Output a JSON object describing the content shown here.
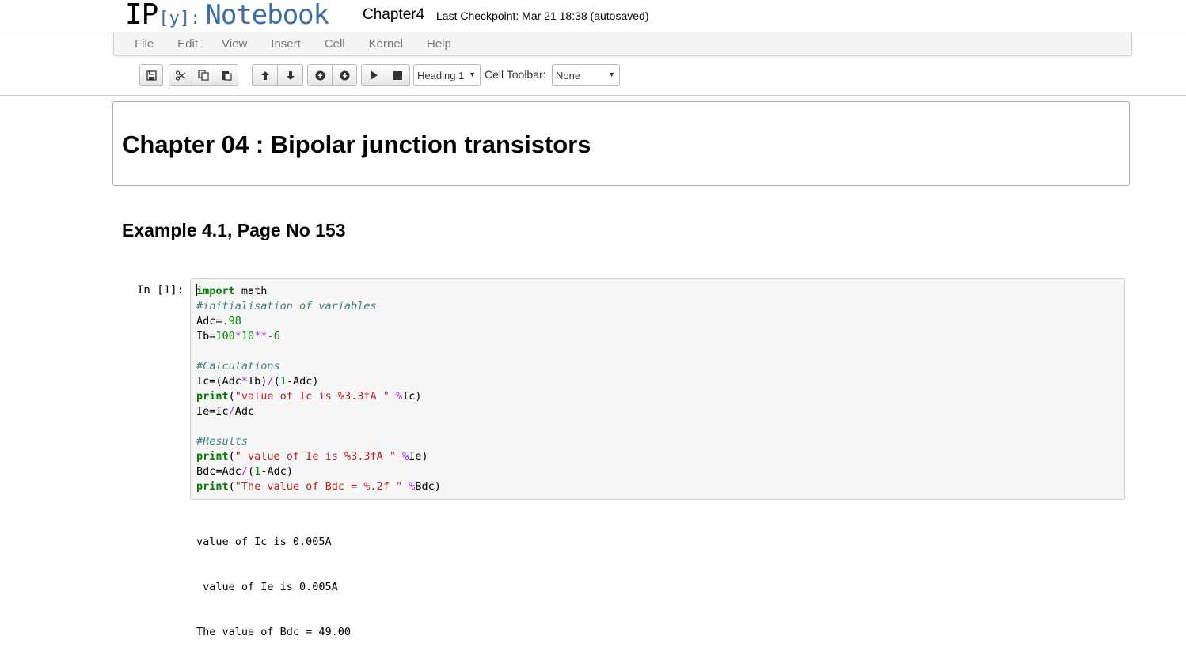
{
  "header": {
    "logo_ip": "IP",
    "logo_y": "[y]:",
    "logo_notebook": "Notebook",
    "notebook_name": "Chapter4",
    "checkpoint": "Last Checkpoint: Mar 21 18:38 (autosaved)"
  },
  "menu": {
    "items": [
      "File",
      "Edit",
      "View",
      "Insert",
      "Cell",
      "Kernel",
      "Help"
    ]
  },
  "toolbar": {
    "icons": [
      "save-icon",
      "cut-icon",
      "copy-icon",
      "paste-icon",
      "arrow-up-icon",
      "arrow-down-icon",
      "insert-above-icon",
      "insert-below-icon",
      "run-icon",
      "stop-icon"
    ],
    "cell_type_value": "Heading 1",
    "cell_toolbar_label": "Cell Toolbar:",
    "cell_toolbar_value": "None"
  },
  "cells": {
    "heading1": "Chapter 04 : Bipolar junction transistors",
    "heading2": "Example 4.1, Page No 153",
    "prompt": "In [1]:",
    "output": [
      "value of Ic is 0.005A",
      " value of Ie is 0.005A",
      "The value of Bdc = 49.00"
    ]
  },
  "code_lines": [
    [
      {
        "t": "import",
        "c": "kw"
      },
      {
        "t": " math",
        "c": ""
      }
    ],
    [
      {
        "t": "#initialisation of variables",
        "c": "cm"
      }
    ],
    [
      {
        "t": "Adc=",
        "c": ""
      },
      {
        "t": ".98",
        "c": "num"
      }
    ],
    [
      {
        "t": "Ib=",
        "c": ""
      },
      {
        "t": "100",
        "c": "num"
      },
      {
        "t": "*",
        "c": "op"
      },
      {
        "t": "10",
        "c": "num"
      },
      {
        "t": "**-",
        "c": "op"
      },
      {
        "t": "6",
        "c": "num"
      }
    ],
    [],
    [
      {
        "t": "#Calculations",
        "c": "cm"
      }
    ],
    [
      {
        "t": "Ic=(Adc",
        "c": ""
      },
      {
        "t": "*",
        "c": "op"
      },
      {
        "t": "Ib)",
        "c": ""
      },
      {
        "t": "/",
        "c": "op"
      },
      {
        "t": "(",
        "c": ""
      },
      {
        "t": "1",
        "c": "num"
      },
      {
        "t": "-Adc)",
        "c": ""
      }
    ],
    [
      {
        "t": "print",
        "c": "kw"
      },
      {
        "t": "(",
        "c": ""
      },
      {
        "t": "\"value of Ic is %3.3fA \"",
        "c": "str"
      },
      {
        "t": " ",
        "c": ""
      },
      {
        "t": "%",
        "c": "op"
      },
      {
        "t": "Ic)",
        "c": ""
      }
    ],
    [
      {
        "t": "Ie=Ic",
        "c": ""
      },
      {
        "t": "/",
        "c": "op"
      },
      {
        "t": "Adc",
        "c": ""
      }
    ],
    [],
    [
      {
        "t": "#Results",
        "c": "cm"
      }
    ],
    [
      {
        "t": "print",
        "c": "kw"
      },
      {
        "t": "(",
        "c": ""
      },
      {
        "t": "\" value of Ie is %3.3fA \"",
        "c": "str"
      },
      {
        "t": " ",
        "c": ""
      },
      {
        "t": "%",
        "c": "op"
      },
      {
        "t": "Ie)",
        "c": ""
      }
    ],
    [
      {
        "t": "Bdc=Adc",
        "c": ""
      },
      {
        "t": "/",
        "c": "op"
      },
      {
        "t": "(",
        "c": ""
      },
      {
        "t": "1",
        "c": "num"
      },
      {
        "t": "-Adc)",
        "c": ""
      }
    ],
    [
      {
        "t": "print",
        "c": "kw"
      },
      {
        "t": "(",
        "c": ""
      },
      {
        "t": "\"The value of Bdc = %.2f \"",
        "c": "str"
      },
      {
        "t": " ",
        "c": ""
      },
      {
        "t": "%",
        "c": "op"
      },
      {
        "t": "Bdc)",
        "c": ""
      }
    ]
  ]
}
